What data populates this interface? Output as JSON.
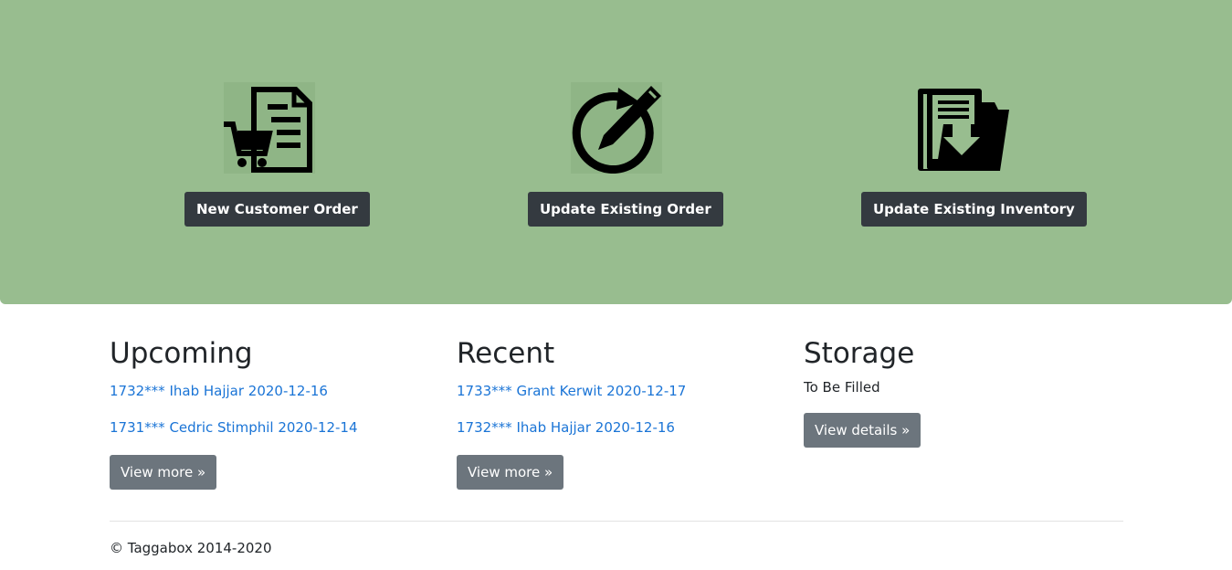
{
  "actions": [
    {
      "label": "New Customer Order",
      "icon": "cart-order-icon"
    },
    {
      "label": "Update Existing Order",
      "icon": "edit-refresh-icon"
    },
    {
      "label": "Update Existing Inventory",
      "icon": "folder-download-icon"
    }
  ],
  "upcoming": {
    "title": "Upcoming",
    "items": [
      "1732*** Ihab Hajjar 2020-12-16",
      "1731*** Cedric Stimphil 2020-12-14"
    ],
    "button": "View more »"
  },
  "recent": {
    "title": "Recent",
    "items": [
      "1733*** Grant Kerwit 2020-12-17",
      "1732*** Ihab Hajjar 2020-12-16"
    ],
    "button": "View more »"
  },
  "storage": {
    "title": "Storage",
    "text": "To Be Filled",
    "button": "View details »"
  },
  "footer": "© Taggabox 2014-2020",
  "colors": {
    "hero": "#98bd8f",
    "dark_button": "#343a40",
    "gray_button": "#6c757d",
    "link": "#1a74d6"
  }
}
